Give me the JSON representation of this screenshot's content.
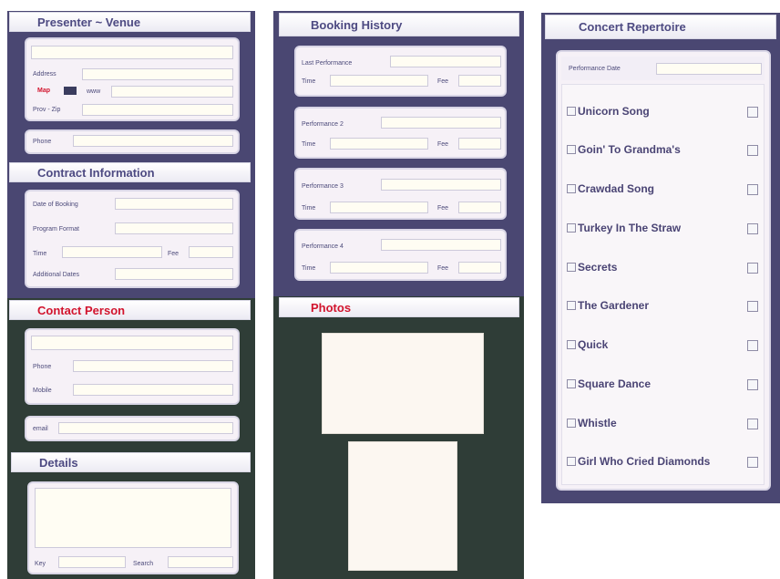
{
  "left": {
    "presenter": {
      "title": "Presenter ~ Venue",
      "address_label": "Address",
      "map_label": "Map",
      "www_label": "www",
      "prov_zip_label": "Prov - Zip",
      "phone_label": "Phone"
    },
    "contract": {
      "title": "Contract Information",
      "date_label": "Date of Booking",
      "format_label": "Program Format",
      "time_label": "Time",
      "fee_label": "Fee",
      "additional_label": "Additional Dates"
    },
    "contact": {
      "title": "Contact Person",
      "phone_label": "Phone",
      "mobile_label": "Mobile",
      "email_label": "email"
    },
    "details": {
      "title": "Details",
      "key_label": "Key",
      "search_label": "Search"
    }
  },
  "middle": {
    "booking": {
      "title": "Booking History",
      "performances": [
        {
          "label": "Last Performance",
          "time_label": "Time",
          "fee_label": "Fee"
        },
        {
          "label": "Performance 2",
          "time_label": "Time",
          "fee_label": "Fee"
        },
        {
          "label": "Performance 3",
          "time_label": "Time",
          "fee_label": "Fee"
        },
        {
          "label": "Performance 4",
          "time_label": "Time",
          "fee_label": "Fee"
        }
      ]
    },
    "photos": {
      "title": "Photos"
    }
  },
  "right": {
    "title": "Concert Repertoire",
    "perf_date_label": "Performance Date",
    "songs": [
      "Unicorn Song",
      "Goin' To Grandma's",
      "Crawdad Song",
      "Turkey In The Straw",
      "Secrets",
      "The Gardener",
      "Quick",
      "Square Dance",
      "Whistle",
      "Girl Who Cried Diamonds"
    ]
  },
  "colors": {
    "navy": "#4a4772",
    "dark_green": "#2f3d37",
    "header_text": "#4d4a82",
    "red_header": "#d2142d",
    "field_bg": "#fffdf3"
  }
}
